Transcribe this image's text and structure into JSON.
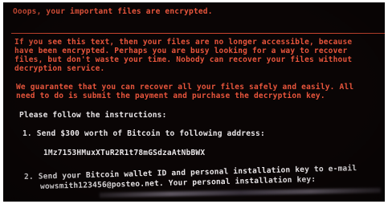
{
  "header": {
    "title": "Ooops, your important files are encrypted."
  },
  "intro": {
    "line1": "If you see this text, then your files are no longer accessible, because",
    "line2": "have been encrypted.  Perhaps you are busy looking for a way to recover",
    "line3": "files, but don't waste your time.  Nobody can recover your files without",
    "line4": "decryption service."
  },
  "guarantee": {
    "line1": "We guarantee that you can recover all your files safely and easily.  All",
    "line2": "need to do is submit the payment and purchase the decryption key."
  },
  "instructions": {
    "heading": "Please follow the instructions:",
    "step1": "1. Send $300 worth of Bitcoin to following address:",
    "address": "1Mz7153HMuxXTuR2R1t78mGSdzaAtNbBWX",
    "step2_line1": "2. Send your Bitcoin wallet ID and personal installation key to e-mail",
    "step2_line2": "wowsmith123456@posteo.net. Your personal installation key:"
  },
  "colors": {
    "background": "#0a0505",
    "accent_red": "#e8553c",
    "text_white": "#e9e6e8"
  }
}
